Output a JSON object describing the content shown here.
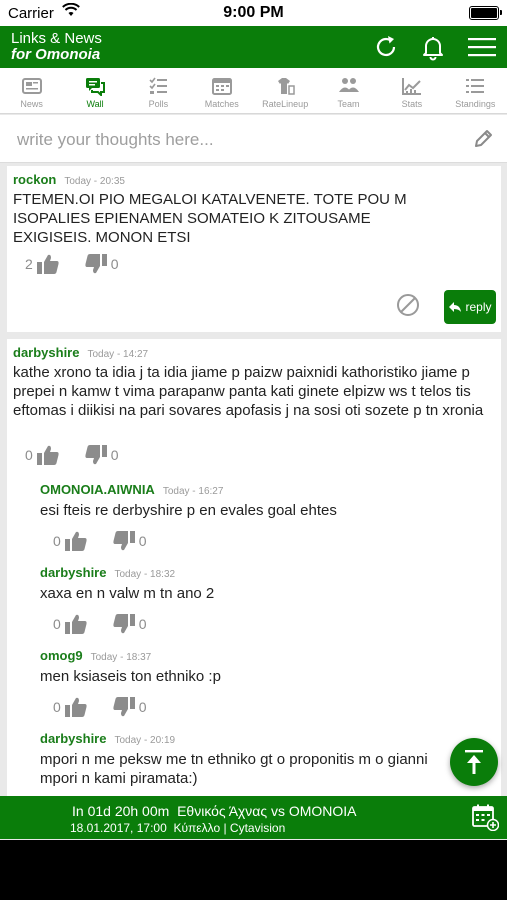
{
  "status_bar": {
    "carrier": "Carrier",
    "time": "9:00 PM"
  },
  "header": {
    "title_line1": "Links & News",
    "title_line2": "for Omonoia"
  },
  "tabs": [
    {
      "label": "News"
    },
    {
      "label": "Wall"
    },
    {
      "label": "Polls"
    },
    {
      "label": "Matches"
    },
    {
      "label": "RateLineup"
    },
    {
      "label": "Team"
    },
    {
      "label": "Stats"
    },
    {
      "label": "Standings"
    }
  ],
  "compose": {
    "placeholder": "write your thoughts here..."
  },
  "posts": [
    {
      "author": "rockon",
      "time": "Today - 20:35",
      "text": "FTEMEN.OI PIO MEGALOI KATALVENETE. TOTE POU M ISOPALIES EPIENAMEN SOMATEIO K ZITOUSAME EXIGISEIS. MONON ETSI",
      "likes": "2",
      "dislikes": "0",
      "reply_label": "reply"
    },
    {
      "author": "darbyshire",
      "time": "Today - 14:27",
      "text": "kathe xrono ta idia j ta idia jiame p paizw paixnidi kathoristiko jiame p prepei n kamw t vima parapanw panta kati ginete elpizw ws t telos tis eftomas i diikisi na pari sovares apofasis j na sosi oti sozete p tn xronia",
      "likes": "0",
      "dislikes": "0",
      "replies": [
        {
          "author": "OMONOIA.AIWNIA",
          "time": "Today - 16:27",
          "text": "esi fteis re derbyshire p en evales goal ehtes",
          "likes": "0",
          "dislikes": "0"
        },
        {
          "author": "darbyshire",
          "time": "Today - 18:32",
          "text": "xaxa en n valw m tn ano 2",
          "likes": "0",
          "dislikes": "0"
        },
        {
          "author": "omog9",
          "time": "Today - 18:37",
          "text": "men ksiaseis ton ethniko :p",
          "likes": "0",
          "dislikes": "0"
        },
        {
          "author": "darbyshire",
          "time": "Today - 20:19",
          "text": "mpori n me peksw me tn ethniko gt o proponitis m o gianni mpori n kami piramata:)"
        }
      ]
    }
  ],
  "next_match": {
    "countdown": "In 01d 20h 00m",
    "teams": "Εθνικός Άχνας vs OMONOIA",
    "date": "18.01.2017, 17:00",
    "info": "Κύπελλο | Cytavision"
  },
  "colors": {
    "brand_green": "#0a7d0a",
    "author_green": "#1a7d1a"
  }
}
